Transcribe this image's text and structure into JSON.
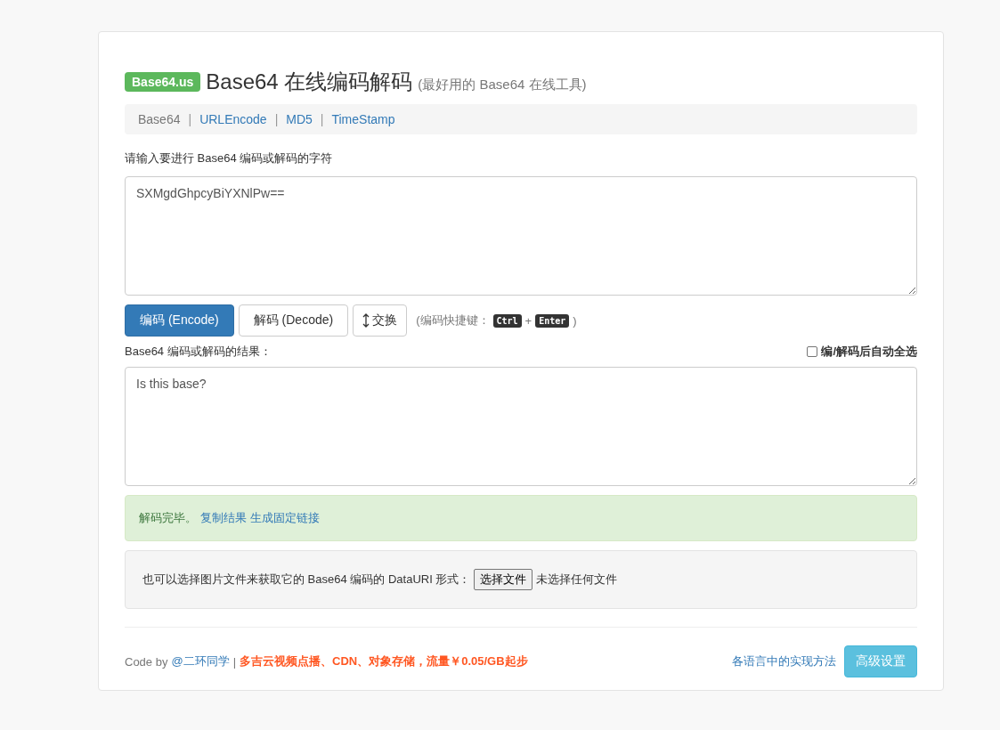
{
  "header": {
    "badge": "Base64.us",
    "title": "Base64 在线编码解码",
    "subtitle": "(最好用的 Base64 在线工具)"
  },
  "nav": [
    {
      "kind": "item",
      "label": "Base64",
      "selected": true
    },
    {
      "kind": "separator",
      "label": "|"
    },
    {
      "kind": "item",
      "label": "URLEncode",
      "selected": false
    },
    {
      "kind": "separator",
      "label": "|"
    },
    {
      "kind": "item",
      "label": "MD5",
      "selected": false
    },
    {
      "kind": "separator",
      "label": "|"
    },
    {
      "kind": "item",
      "label": "TimeStamp",
      "selected": false
    }
  ],
  "input": {
    "label": "请输入要进行 Base64 编码或解码的字符",
    "value": "SXMgdGhpcyBiYXNlPw=="
  },
  "actions": [
    {
      "kind": "primary",
      "label": "编码 (Encode)"
    },
    {
      "kind": "default",
      "label": "解码 (Decode)"
    },
    {
      "kind": "swap",
      "label": "交换"
    }
  ],
  "shortcut_hint": [
    {
      "kind": "text",
      "label": "(编码快捷键："
    },
    {
      "kind": "key",
      "label": "Ctrl"
    },
    {
      "kind": "text",
      "label": "+"
    },
    {
      "kind": "key",
      "label": "Enter"
    },
    {
      "kind": "text",
      "label": ")"
    }
  ],
  "output": {
    "label": "Base64 编码或解码的结果：",
    "value": "Is this base?"
  },
  "auto_select": {
    "label": "编/解码后自动全选",
    "checked": false
  },
  "alert": {
    "message": "解码完毕。",
    "links": [
      "复制结果",
      "生成固定链接"
    ]
  },
  "file_box": {
    "label": "也可以选择图片文件来获取它的 Base64 编码的 DataURI 形式：",
    "button": "选择文件",
    "status": "未选择任何文件"
  },
  "footer": {
    "credit": "Code by",
    "author": "@二环同学",
    "separator": "|",
    "promo": "多吉云视频点播、CDN、对象存储，流量￥0.05/GB起步",
    "impl_link": "各语言中的实现方法",
    "settings_button": "高级设置"
  }
}
